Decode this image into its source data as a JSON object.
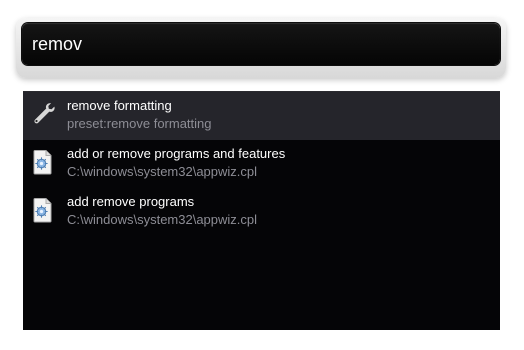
{
  "search": {
    "value": "remov"
  },
  "results": [
    {
      "title": "remove formatting",
      "subtitle": "preset:remove formatting",
      "icon": "wrench-icon",
      "selected": true
    },
    {
      "title": "add or remove programs and features",
      "subtitle": "C:\\windows\\system32\\appwiz.cpl",
      "icon": "control-panel-file-icon",
      "selected": false
    },
    {
      "title": "add remove programs",
      "subtitle": "C:\\windows\\system32\\appwiz.cpl",
      "icon": "control-panel-file-icon",
      "selected": false
    }
  ]
}
